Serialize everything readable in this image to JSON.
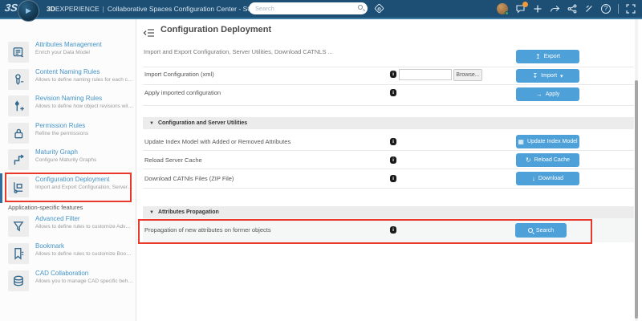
{
  "topbar": {
    "logo": "3S",
    "brand_bold": "3D",
    "brand_rest": "EXPERIENCE",
    "separator": "|",
    "app_title": "Collaborative Spaces Configuration Center - SOLIDWORKS PM Te ...",
    "chevron": "▾",
    "search": {
      "placeholder": "Search"
    }
  },
  "sidebar": {
    "items": [
      {
        "title": "Attributes Management",
        "desc": "Enrich your Data Model"
      },
      {
        "title": "Content Naming Rules",
        "desc": "Allows to define naming rules for each content type"
      },
      {
        "title": "Revision Naming Rules",
        "desc": "Allows to define how object revisions will be name..."
      },
      {
        "title": "Permission Rules",
        "desc": "Refine the permissions"
      },
      {
        "title": "Maturity Graph",
        "desc": "Configure Maturity Graphs"
      },
      {
        "title": "Configuration Deployment",
        "desc": "Import and Export Configuration, Server Utilities, Do..."
      },
      {
        "title": "Advanced Filter",
        "desc": "Allows to define rules to customize Advanced Filte..."
      },
      {
        "title": "Bookmark",
        "desc": "Allows to define rules to customize Bookmark beh..."
      },
      {
        "title": "CAD Collaboration",
        "desc": "Allows you to manage CAD specific behavior like ..."
      }
    ],
    "section_label": "Application-specific features"
  },
  "main": {
    "title": "Configuration Deployment",
    "subtitle": "Import and Export Configuration, Server Utilities, Download CATNLS ...",
    "sections": {
      "utilities": {
        "arrow": "▼",
        "title": "Configuration and Server Utilities"
      },
      "propagation": {
        "arrow": "▼",
        "title": "Attributes Propagation"
      }
    },
    "rows": {
      "export": {
        "button": "Export",
        "icon": "↥"
      },
      "import": {
        "label": "Import Configuration (xml)",
        "browse": "Browse...",
        "button": "Import",
        "icon": "↧",
        "dropdown": "▾"
      },
      "apply": {
        "label": "Apply imported configuration",
        "button": "Apply",
        "icon": "→"
      },
      "update_index": {
        "label": "Update Index Model with Added or Removed Attributes",
        "button": "Update Index Model",
        "icon": "▦"
      },
      "reload_cache": {
        "label": "Reload Server Cache",
        "button": "Reload Cache",
        "icon": "↻"
      },
      "download": {
        "label": "Download CATNls Files (ZIP File)",
        "button": "Download",
        "icon": "↓"
      },
      "propagation": {
        "label": "Propagation of new attributes on former objects",
        "button": "Search"
      }
    }
  },
  "colors": {
    "topbar": "#1d4e74",
    "accent_button": "#4da0d8",
    "annotation_red": "#e8392b",
    "selected_bar": "#2f6f9f",
    "link_blue": "#4594c7"
  }
}
